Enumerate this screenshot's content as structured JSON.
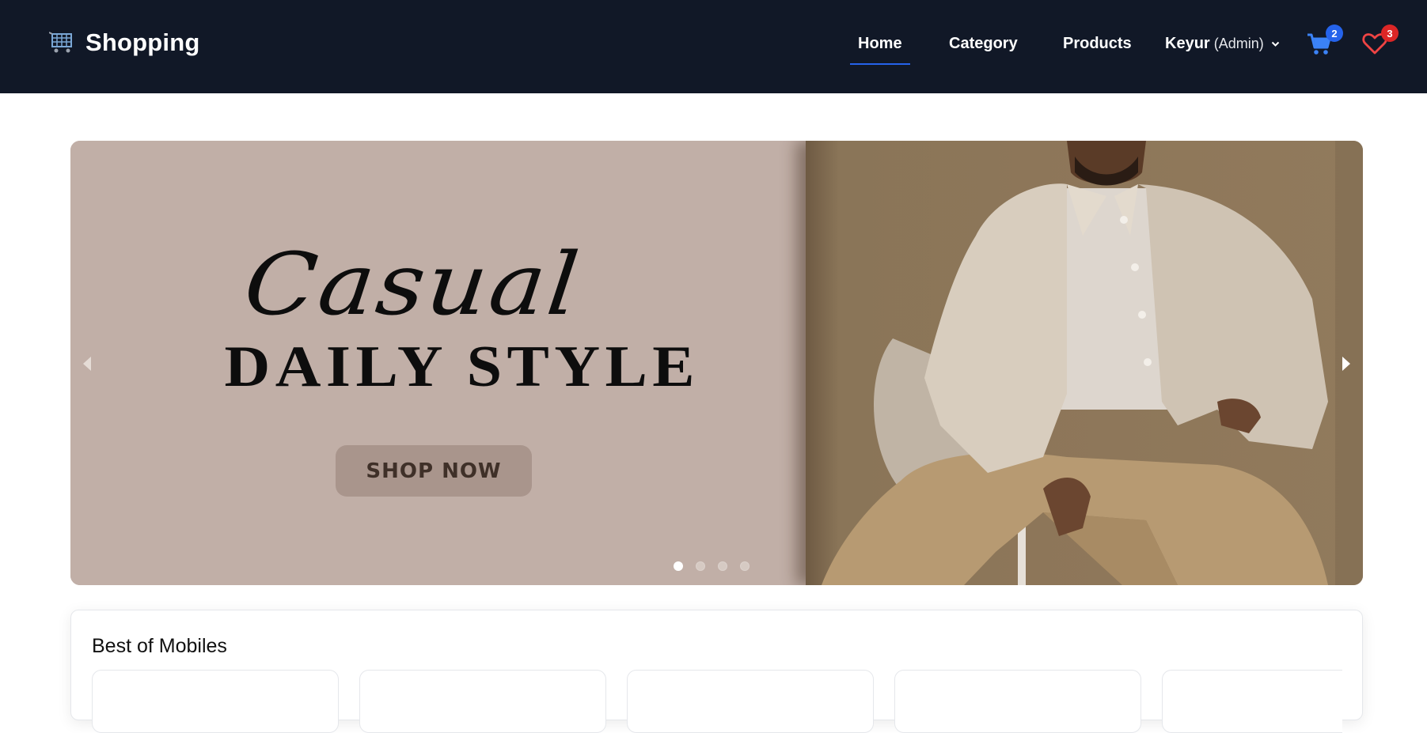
{
  "navbar": {
    "brand": "Shopping",
    "brand_icon": "shopping-cart-icon",
    "links": [
      "Home",
      "Category",
      "Products"
    ],
    "active_link": "Home",
    "user": {
      "name": "Keyur",
      "role": "(Admin)"
    },
    "cart_count": "2",
    "wishlist_count": "3",
    "colors": {
      "background": "#111827",
      "accent": "#2563eb",
      "wishlist_badge": "#dc2626"
    }
  },
  "carousel": {
    "script_text": "Casual",
    "headline": "DAILY STYLE",
    "cta_label": "SHOP NOW",
    "slide_count": 4,
    "active_slide": 1,
    "colors": {
      "left_panel": "#c1afa7",
      "cta": "#a9958c"
    }
  },
  "sections": [
    {
      "title": "Best of Mobiles"
    }
  ]
}
